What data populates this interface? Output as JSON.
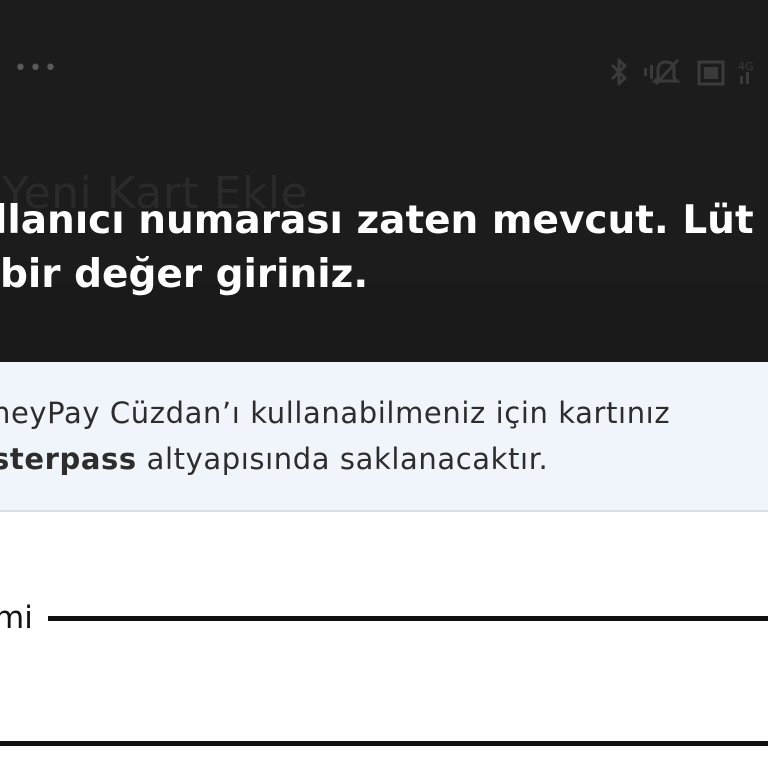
{
  "status_bar": {
    "overflow_dots": "•••",
    "icons": [
      "bluetooth-icon",
      "mute-icon",
      "vibrate-icon",
      "signal-4g-icon"
    ]
  },
  "page": {
    "title": "Yeni Kart Ekle"
  },
  "toast": {
    "line1": "llanıcı numarası zaten mevcut. Lüt",
    "line2": "bir değer giriniz."
  },
  "info_box": {
    "line1": "neyPay Cüzdan’ı kullanabilmeniz için kartınız",
    "line2_bold": "sterpass",
    "line2_rest": " altyapısında saklanacaktır."
  },
  "form": {
    "field_label": "mi"
  },
  "colors": {
    "overlay": "#1c1c1c",
    "info_bg": "#eff5fa",
    "text": "#2d2d2d"
  }
}
